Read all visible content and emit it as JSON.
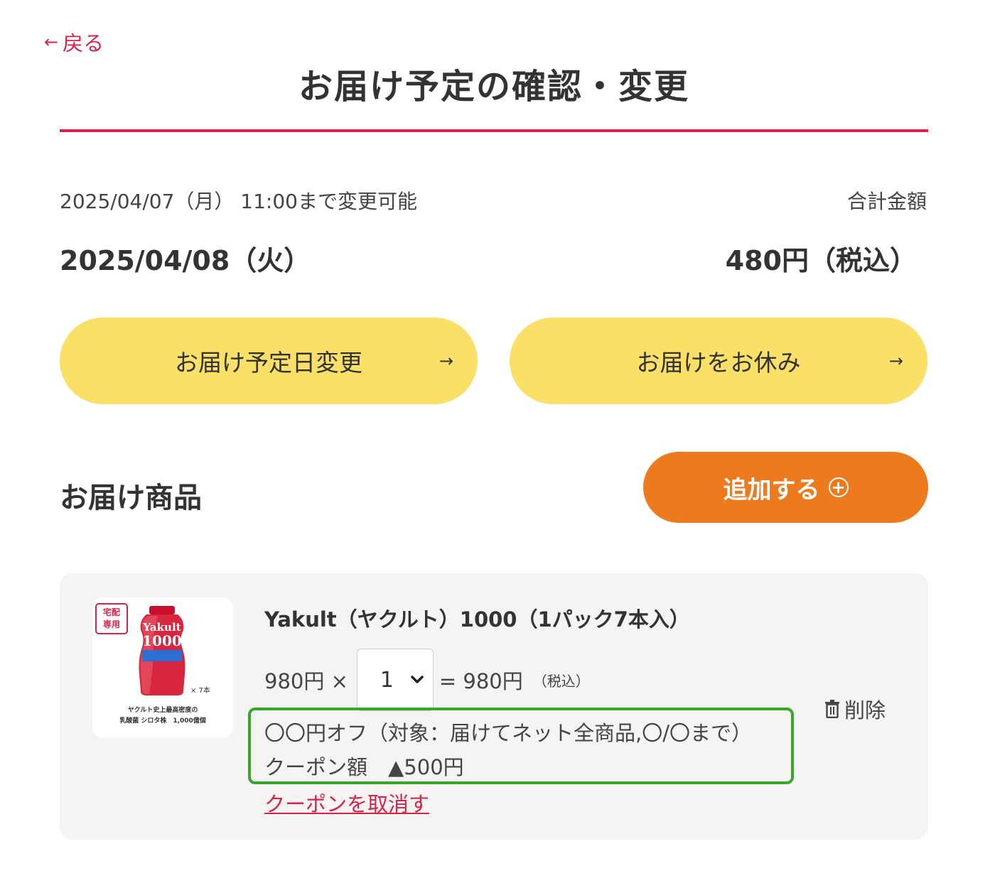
{
  "header": {
    "back_label": "戻る",
    "title": "お届け予定の確認・変更"
  },
  "schedule": {
    "deadline_text": "2025/04/07（月） 11:00まで変更可能",
    "delivery_date": "2025/04/08（火）",
    "total_label": "合計金額",
    "total_amount": "480円（税込）"
  },
  "actions": {
    "change_date_label": "お届け予定日変更",
    "skip_label": "お届けをお休み"
  },
  "products_section": {
    "title": "お届け商品",
    "add_label": "追加する"
  },
  "product": {
    "badge_line1": "宅配",
    "badge_line2": "専用",
    "bottle_brand": "Yakult",
    "bottle_number": "1000",
    "bottle_count": "× 7本",
    "caption_line1": "ヤクルト史上最高密度の",
    "caption_line2": "乳酸菌 シロタ株　1,000億個",
    "name": "Yakult（ヤクルト）1000（1パック7本入）",
    "unit_price": "980円 ×",
    "quantity": "1",
    "subtotal": "= 980円",
    "tax_note": "（税込）",
    "coupon_description": "〇〇円オフ（対象：届けてネット全商品,〇/〇まで）",
    "coupon_amount": "クーポン額　▲500円",
    "coupon_cancel_label": "クーポンを取消す",
    "delete_label": "削除"
  },
  "colors": {
    "accent_red": "#d9224a",
    "button_yellow": "#fbe068",
    "button_orange": "#ee7a1e",
    "coupon_highlight_green": "#38a82a",
    "card_background": "#f5f4f3"
  }
}
